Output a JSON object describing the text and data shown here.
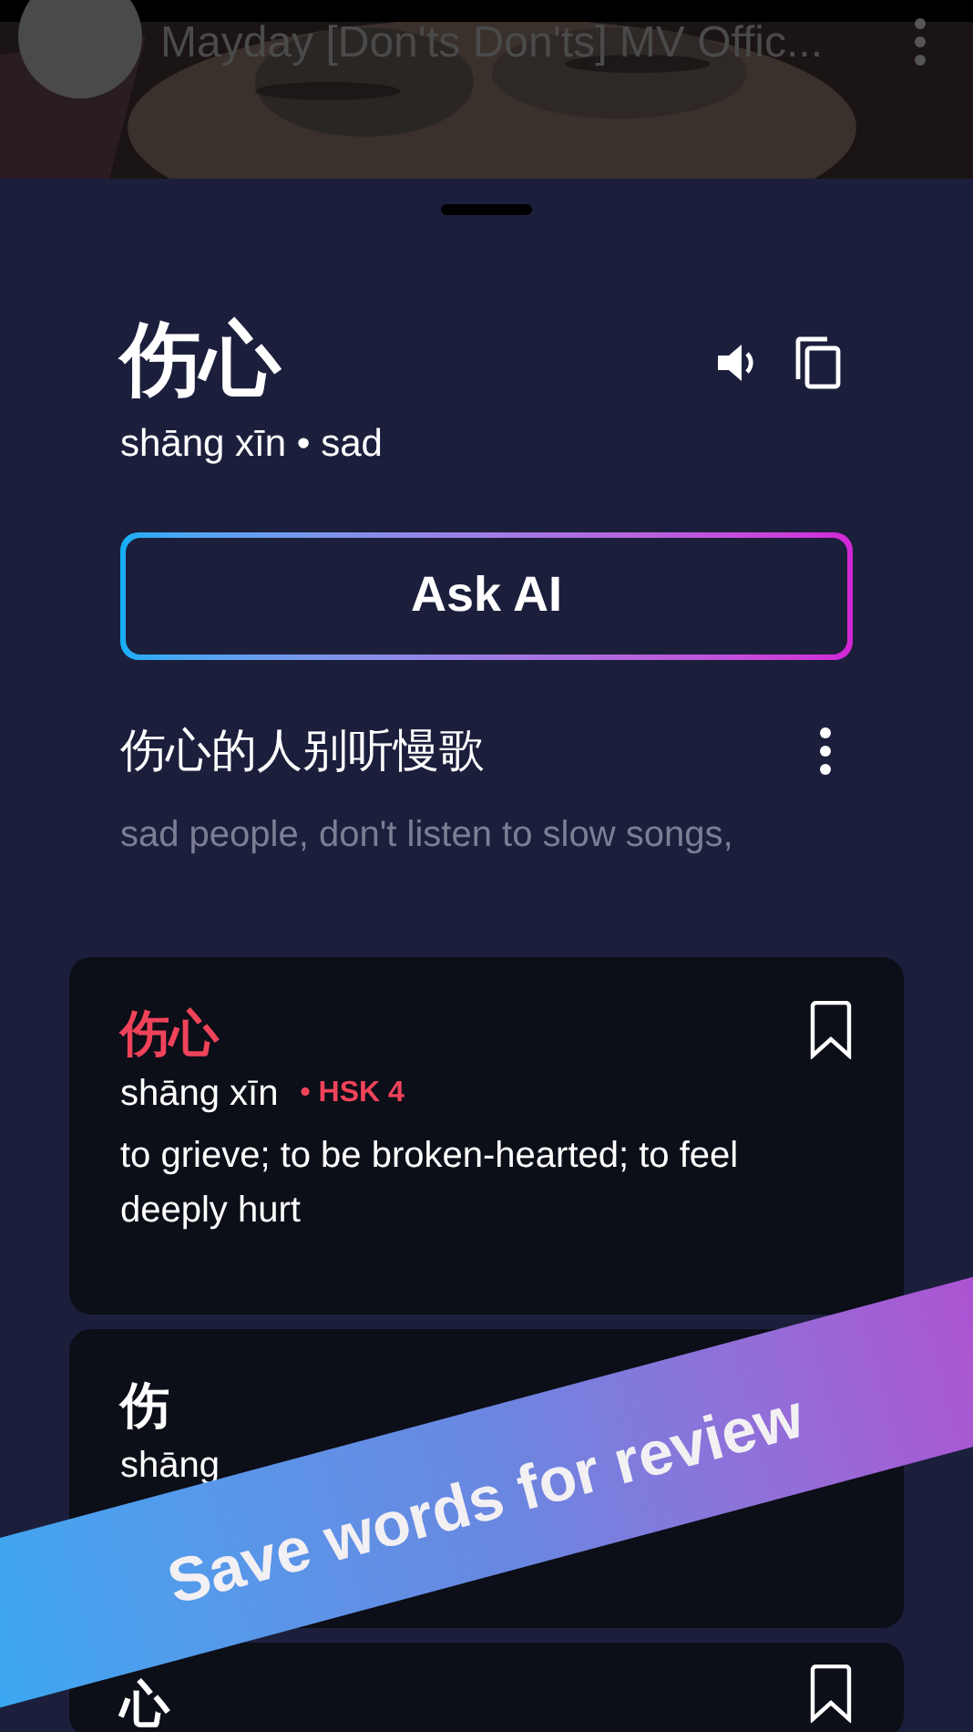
{
  "video": {
    "title": "Mayday [Don'ts Don'ts] MV Offic..."
  },
  "word": {
    "hanzi": "伤心",
    "subtitle": "shāng xīn • sad"
  },
  "ask_button": {
    "label": "Ask AI"
  },
  "sentence": {
    "text": "伤心的人别听慢歌",
    "translation": "sad people, don't listen to slow songs,"
  },
  "cards": [
    {
      "hanzi": "伤心",
      "highlight": true,
      "pinyin": "shāng xīn",
      "hsk": "• HSK 4",
      "definition": "to grieve; to be broken-hearted; to feel deeply hurt",
      "bookmark": true
    },
    {
      "hanzi": "伤",
      "highlight": false,
      "pinyin": "shāng"
    },
    {
      "hanzi": "心",
      "highlight": false,
      "bookmark": true
    }
  ],
  "banner": {
    "text": "Save words for review"
  }
}
